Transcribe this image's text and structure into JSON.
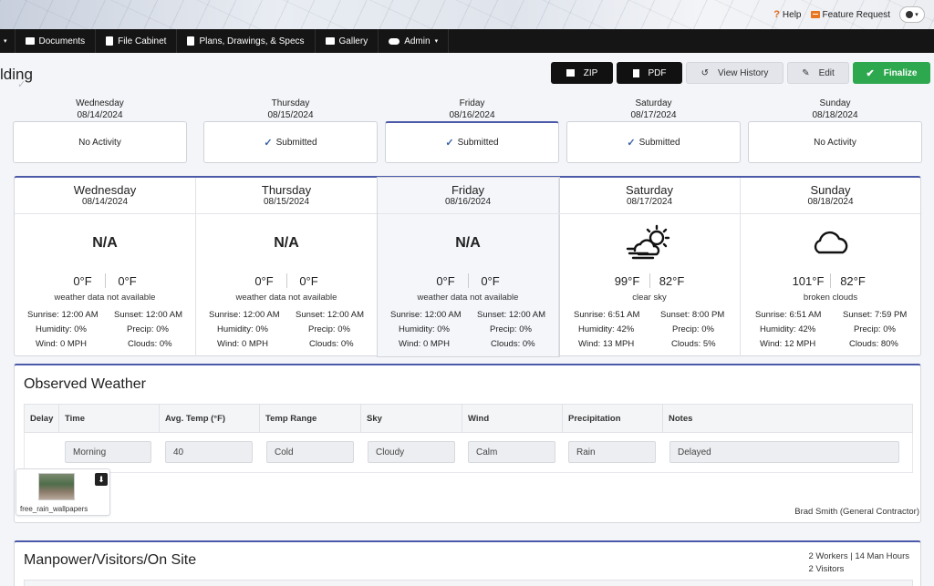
{
  "header": {
    "help": "Help",
    "feature_request": "Feature Request"
  },
  "nav": {
    "items": [
      "Documents",
      "File Cabinet",
      "Plans, Drawings, & Specs",
      "Gallery",
      "Admin"
    ]
  },
  "page": {
    "title": "lding"
  },
  "toolbar": {
    "zip": "ZIP",
    "pdf": "PDF",
    "view_history": "View History",
    "edit": "Edit",
    "finalize": "Finalize"
  },
  "days": [
    {
      "name": "Wednesday",
      "date": "08/14/2024",
      "status": "No Activity",
      "submitted": false
    },
    {
      "name": "Thursday",
      "date": "08/15/2024",
      "status": "Submitted",
      "submitted": true
    },
    {
      "name": "Friday",
      "date": "08/16/2024",
      "status": "Submitted",
      "submitted": true
    },
    {
      "name": "Saturday",
      "date": "08/17/2024",
      "status": "Submitted",
      "submitted": true
    },
    {
      "name": "Sunday",
      "date": "08/18/2024",
      "status": "No Activity",
      "submitted": false
    }
  ],
  "forecast": [
    {
      "name": "Wednesday",
      "date": "08/14/2024",
      "icon": "na",
      "na": "N/A",
      "high": "0°F",
      "low": "0°F",
      "condition": "weather data not available",
      "sunrise": "12:00 AM",
      "sunset": "12:00 AM",
      "humidity": "0%",
      "precip": "0%",
      "wind": "0 MPH",
      "clouds": "0%"
    },
    {
      "name": "Thursday",
      "date": "08/15/2024",
      "icon": "na",
      "na": "N/A",
      "high": "0°F",
      "low": "0°F",
      "condition": "weather data not available",
      "sunrise": "12:00 AM",
      "sunset": "12:00 AM",
      "humidity": "0%",
      "precip": "0%",
      "wind": "0 MPH",
      "clouds": "0%"
    },
    {
      "name": "Friday",
      "date": "08/16/2024",
      "icon": "na",
      "na": "N/A",
      "high": "0°F",
      "low": "0°F",
      "condition": "weather data not available",
      "sunrise": "12:00 AM",
      "sunset": "12:00 AM",
      "humidity": "0%",
      "precip": "0%",
      "wind": "0 MPH",
      "clouds": "0%"
    },
    {
      "name": "Saturday",
      "date": "08/17/2024",
      "icon": "sun-cloud-wind-icon",
      "na": "",
      "high": "99°F",
      "low": "82°F",
      "condition": "clear sky",
      "sunrise": "6:51 AM",
      "sunset": "8:00 PM",
      "humidity": "42%",
      "precip": "0%",
      "wind": "13 MPH",
      "clouds": "5%"
    },
    {
      "name": "Sunday",
      "date": "08/18/2024",
      "icon": "cloud-icon",
      "na": "",
      "high": "101°F",
      "low": "82°F",
      "condition": "broken clouds",
      "sunrise": "6:51 AM",
      "sunset": "7:59 PM",
      "humidity": "42%",
      "precip": "0%",
      "wind": "12 MPH",
      "clouds": "80%"
    }
  ],
  "labels": {
    "sunrise": "Sunrise:",
    "sunset": "Sunset:",
    "humidity": "Humidity:",
    "precip": "Precip:",
    "wind": "Wind:",
    "clouds": "Clouds:"
  },
  "observed": {
    "title": "Observed Weather",
    "columns": [
      "Delay",
      "Time",
      "Avg. Temp (°F)",
      "Temp Range",
      "Sky",
      "Wind",
      "Precipitation",
      "Notes"
    ],
    "row": {
      "time": "Morning",
      "avg_temp": "40",
      "temp_range": "Cold",
      "sky": "Cloudy",
      "wind": "Calm",
      "precipitation": "Rain",
      "notes": "Delayed"
    },
    "attachment": "free_rain_wallpapers",
    "author": "Brad Smith (General Contractor)"
  },
  "manpower": {
    "title": "Manpower/Visitors/On Site",
    "stats_line1": "2 Workers | 14 Man Hours",
    "stats_line2": "2 Visitors"
  }
}
